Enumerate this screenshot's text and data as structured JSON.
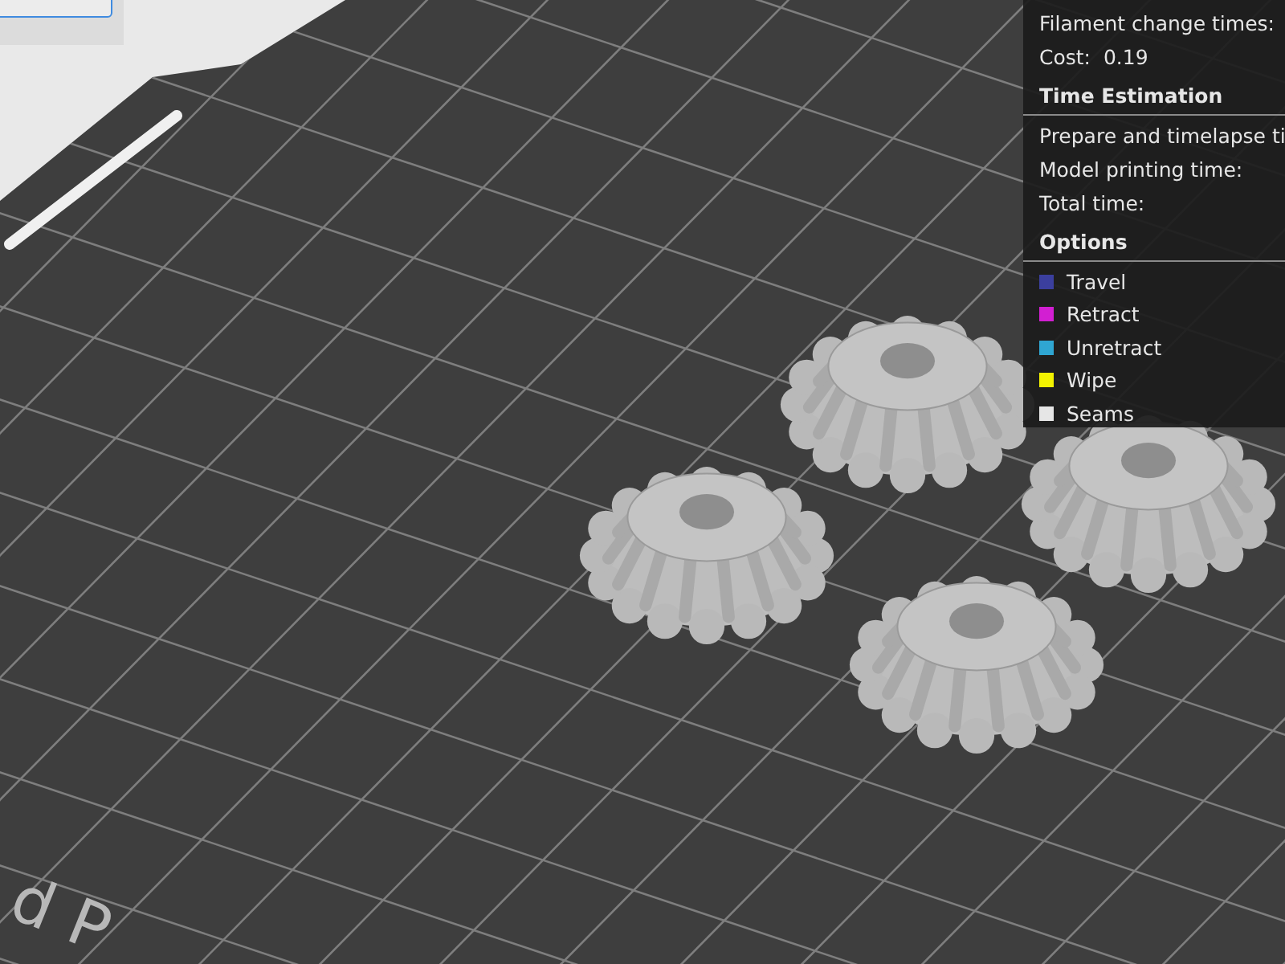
{
  "legend_panel": {
    "summary": [
      {
        "text": "Filament change times:"
      },
      {
        "text": "Cost:  0.19"
      }
    ],
    "time_estimation": {
      "title": "Time Estimation",
      "rows": [
        {
          "text": "Prepare and timelapse ti"
        },
        {
          "text": "Model printing time:"
        },
        {
          "text": "Total time:"
        }
      ]
    },
    "options": {
      "title": "Options",
      "items": [
        {
          "label": "Travel",
          "color": "#3b3f9e"
        },
        {
          "label": "Retract",
          "color": "#d21fd2"
        },
        {
          "label": "Unretract",
          "color": "#2fa6d2"
        },
        {
          "label": "Wipe",
          "color": "#f2f200"
        },
        {
          "label": "Seams",
          "color": "#e6e6e6"
        }
      ]
    }
  },
  "bed_label": "d P"
}
